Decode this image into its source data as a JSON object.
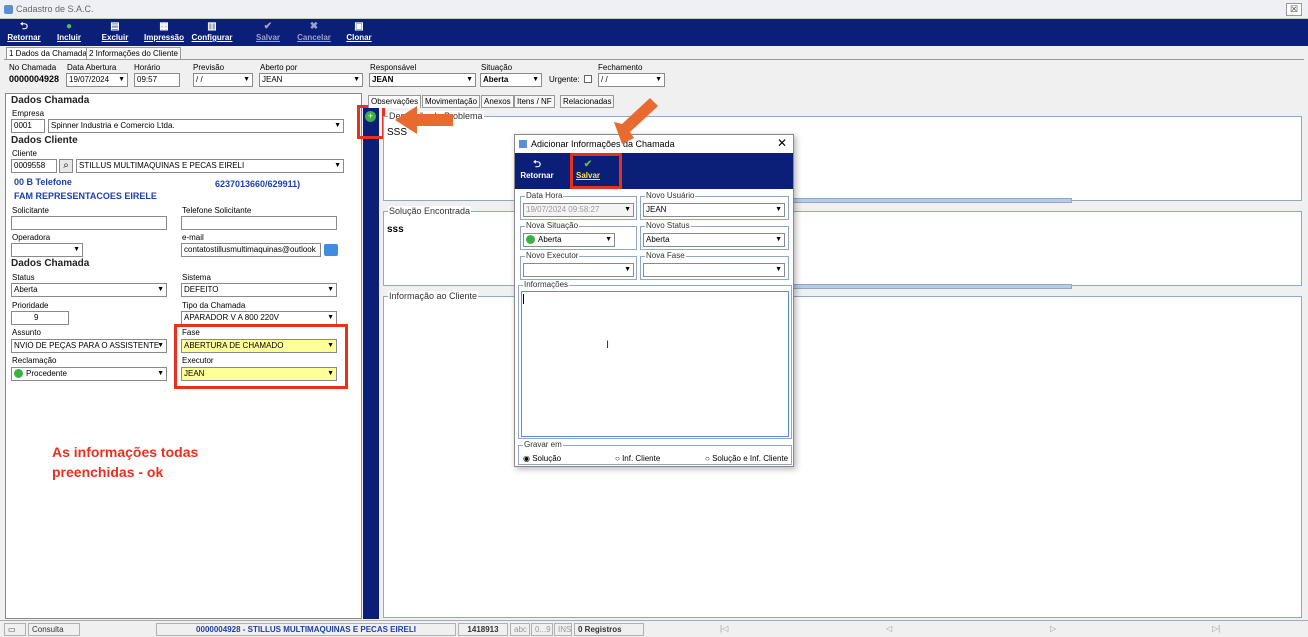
{
  "window": {
    "title": "Cadastro de S.A.C.",
    "close": "☒"
  },
  "toolbar": [
    {
      "icon": "⮌",
      "label": "Retornar"
    },
    {
      "icon": "●",
      "label": "Incluir"
    },
    {
      "icon": "▤",
      "label": "Excluir"
    },
    {
      "icon": "▦",
      "label": "Impressão"
    },
    {
      "icon": "▥",
      "label": "Configurar"
    },
    {
      "icon": "✔",
      "label": "Salvar"
    },
    {
      "icon": "✖",
      "label": "Cancelar"
    },
    {
      "icon": "▣",
      "label": "Clonar"
    }
  ],
  "tabs": [
    "1 Dados da Chamada",
    "2 Informações do Cliente"
  ],
  "header": {
    "no_chamada_label": "No Chamada",
    "no_chamada": "0000004928",
    "data_abertura_label": "Data Abertura",
    "data_abertura": "19/07/2024",
    "horario_label": "Horário",
    "horario": "09:57",
    "previsao_label": "Previsão",
    "previsao": "/ /",
    "aberto_por_label": "Aberto por",
    "aberto_por": "JEAN",
    "responsavel_label": "Responsável",
    "responsavel": "JEAN",
    "situacao_label": "Situação",
    "situacao": "Aberta",
    "urgente_label": "Urgente:",
    "fechamento_label": "Fechamento",
    "fechamento": "/ /"
  },
  "left": {
    "dados_chamada": "Dados Chamada",
    "empresa_label": "Empresa",
    "empresa_code": "0001",
    "empresa_name": "Spinner Industria e Comercio Ltda.",
    "dados_cliente": "Dados Cliente",
    "cliente_label": "Cliente",
    "cliente_code": "0009558",
    "cliente_name": "STILLUS MULTIMAQUINAS E PECAS EIRELI",
    "telefone_line": "00  B  Telefone",
    "telefone_num": "6237013660/629911)",
    "fam": "FAM REPRESENTACOES EIRELE",
    "solicitante_label": "Solicitante",
    "tel_solicitante_label": "Telefone Solicitante",
    "operadora_label": "Operadora",
    "email_label": "e-mail",
    "email": "contatostillusmultimaquinas@outlook",
    "dados_chamada2": "Dados Chamada",
    "status_label": "Status",
    "status": "Aberta",
    "sistema_label": "Sistema",
    "sistema": "DEFEITO",
    "prioridade_label": "Prioridade",
    "prioridade": "9",
    "tipo_label": "Tipo da Chamada",
    "tipo": "APARADOR V A 800 220V",
    "assunto_label": "Assunto",
    "assunto": "NVIO DE PEÇAS PARA O ASSISTENTE",
    "fase_label": "Fase",
    "fase": "ABERTURA DE CHAMADO",
    "reclamacao_label": "Reclamação",
    "reclamacao": "Procedente",
    "executor_label": "Executor",
    "executor": "JEAN",
    "note": "As informações todas preenchidas - ok",
    "note_color": "#e8301c"
  },
  "right": {
    "tabs": [
      "Observações",
      "Movimentação",
      "Anexos",
      "Itens / NF",
      "Relacionadas"
    ],
    "descricao_label": "Descrição do Problema",
    "descricao": "SSS",
    "solucao_label": "Solução Encontrada",
    "solucao": "sss",
    "info_label": "Informação ao Cliente"
  },
  "dialog": {
    "title": "Adicionar Informações da Chamada",
    "retornar": "Retornar",
    "salvar": "Salvar",
    "data_hora_label": "Data Hora",
    "data_hora": "19/07/2024 09:58:27",
    "novo_usuario_label": "Novo Usuário",
    "novo_usuario": "JEAN",
    "nova_situacao_label": "Nova Situação",
    "nova_situacao": "Aberta",
    "novo_status_label": "Novo Status",
    "novo_status": "Aberta",
    "novo_executor_label": "Novo Executor",
    "nova_fase_label": "Nova Fase",
    "informacoes_label": "Informações",
    "gravar_label": "Gravar em",
    "opt1": "Solução",
    "opt2": "Inf. Cliente",
    "opt3": "Solução e Inf. Cliente"
  },
  "status": {
    "consulta": "Consulta",
    "record": "0000004928 - STILLUS MULTIMAQUINAS E PECAS EIRELI",
    "num": "1418913",
    "abc": "abc",
    "range": "0...9",
    "ins": "INS",
    "registros": "0 Registros"
  }
}
